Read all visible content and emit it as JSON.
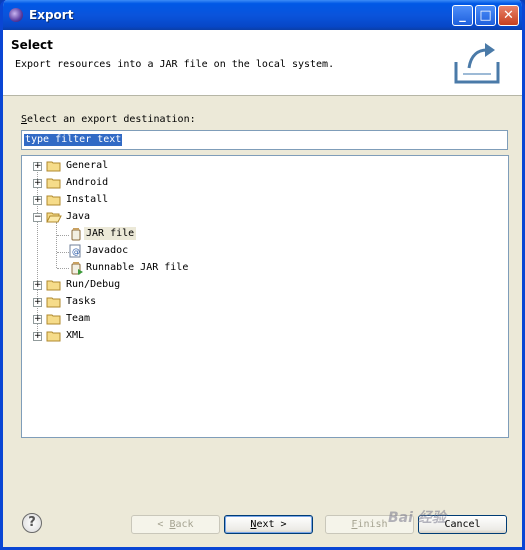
{
  "window": {
    "title": "Export",
    "controls": {
      "minimize": "_",
      "maximize": "□",
      "close": "✕"
    }
  },
  "header": {
    "title": "Select",
    "description": "Export resources into a JAR file on the local system."
  },
  "destination": {
    "label_mnemonic": "S",
    "label_rest": "elect an export destination:",
    "filter_value": "type filter text"
  },
  "tree": {
    "items": [
      {
        "label": "General",
        "expanded": false
      },
      {
        "label": "Android",
        "expanded": false
      },
      {
        "label": "Install",
        "expanded": false
      },
      {
        "label": "Java",
        "expanded": true,
        "children": [
          {
            "label": "JAR file",
            "icon": "jar-file-icon",
            "selected": true
          },
          {
            "label": "Javadoc",
            "icon": "javadoc-icon"
          },
          {
            "label": "Runnable JAR file",
            "icon": "runnable-jar-icon"
          }
        ]
      },
      {
        "label": "Run/Debug",
        "expanded": false
      },
      {
        "label": "Tasks",
        "expanded": false
      },
      {
        "label": "Team",
        "expanded": false
      },
      {
        "label": "XML",
        "expanded": false
      }
    ]
  },
  "buttons": {
    "help": "?",
    "back_prefix": "< ",
    "back_mnemonic": "B",
    "back_rest": "ack",
    "next_mnemonic": "N",
    "next_rest": "ext >",
    "finish_mnemonic": "F",
    "finish_rest": "inish",
    "cancel": "Cancel"
  },
  "watermark": "Bai 经验"
}
